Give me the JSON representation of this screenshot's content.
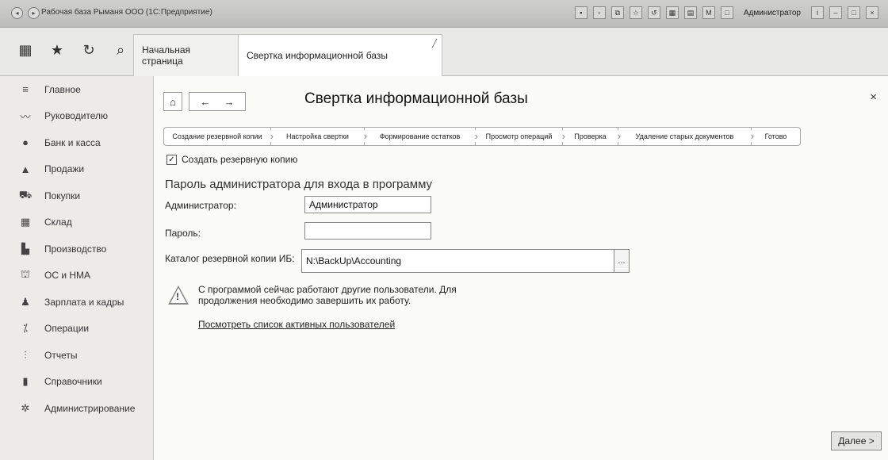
{
  "window": {
    "title": "Рабочая база Рыманя ООО (1С:Предприятие)",
    "user": "Администратор"
  },
  "tabs": {
    "start_label": "Начальная страница",
    "active_label": "Свертка информационной базы"
  },
  "sidebar": {
    "items": [
      {
        "icon": "menu-icon",
        "label": "Главное"
      },
      {
        "icon": "chart-icon",
        "label": "Руководителю"
      },
      {
        "icon": "bank-icon",
        "label": "Банк и касса"
      },
      {
        "icon": "sales-icon",
        "label": "Продажи"
      },
      {
        "icon": "cart-icon",
        "label": "Покупки"
      },
      {
        "icon": "warehouse-icon",
        "label": "Склад"
      },
      {
        "icon": "production-icon",
        "label": "Производство"
      },
      {
        "icon": "assets-icon",
        "label": "ОС и НМА"
      },
      {
        "icon": "person-icon",
        "label": "Зарплата и кадры"
      },
      {
        "icon": "operations-icon",
        "label": "Операции"
      },
      {
        "icon": "reports-icon",
        "label": "Отчеты"
      },
      {
        "icon": "book-icon",
        "label": "Справочники"
      },
      {
        "icon": "gear-icon",
        "label": "Администрирование"
      }
    ]
  },
  "form": {
    "title": "Свертка информационной базы",
    "steps": [
      "Создание резервной копии",
      "Настройка свертки",
      "Формирование остатков",
      "Просмотр операций",
      "Проверка",
      "Удаление старых документов",
      "Готово"
    ],
    "checkbox_label": "Создать резервную копию",
    "checkbox_checked": true,
    "section_title": "Пароль администратора для входа в программу",
    "admin_label": "Администратор:",
    "admin_value": "Администратор",
    "password_label": "Пароль:",
    "password_value": "",
    "backup_label": "Каталог резервной копии ИБ:",
    "backup_value": "N:\\BackUp\\Accounting",
    "browse_label": "...",
    "warning_text_line1": "С программой сейчас работают другие пользователи. Для",
    "warning_text_line2": "продолжения необходимо завершить их работу.",
    "link_text": "Посмотреть список активных пользователей",
    "next_button": "Далее >"
  }
}
